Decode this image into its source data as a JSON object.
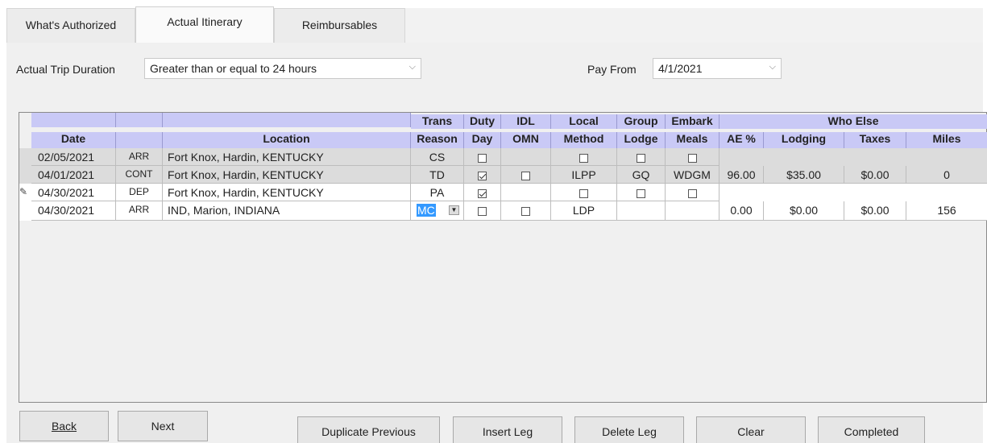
{
  "tabs": [
    {
      "label": "What's Authorized"
    },
    {
      "label": "Actual Itinerary"
    },
    {
      "label": "Reimbursables"
    }
  ],
  "trip_duration": {
    "label": "Actual Trip Duration",
    "value": "Greater than or equal to 24 hours"
  },
  "pay_from": {
    "label": "Pay From",
    "value": "4/1/2021"
  },
  "headers": {
    "date": "Date",
    "location": "Location",
    "trans_top": "Trans",
    "trans_bottom": "Reason",
    "duty_top": "Duty",
    "duty_bottom": "Day",
    "idl_top": "IDL",
    "idl_bottom": "OMN",
    "local_top": "Local",
    "local_bottom": "Method",
    "group_top": "Group",
    "group_bottom": "Lodge",
    "embark_top": "Embark",
    "embark_bottom": "Meals",
    "who_else": "Who Else",
    "ae": "AE %",
    "lodging": "Lodging",
    "taxes": "Taxes",
    "miles": "Miles"
  },
  "rows": [
    {
      "date": "02/05/2021",
      "type": "ARR",
      "location": "Fort Knox, Hardin, KENTUCKY",
      "reason": "CS",
      "local": "",
      "group": "",
      "embark": "",
      "ae": "",
      "lodging": "",
      "taxes": "",
      "miles": ""
    },
    {
      "date": "04/01/2021",
      "type": "CONT",
      "location": "Fort Knox, Hardin, KENTUCKY",
      "reason": "TD",
      "local": "ILPP",
      "group": "GQ",
      "embark": "WDGM",
      "ae": "96.00",
      "lodging": "$35.00",
      "taxes": "$0.00",
      "miles": "0"
    },
    {
      "date": "04/30/2021",
      "type": "DEP",
      "location": "Fort Knox, Hardin, KENTUCKY",
      "reason": "PA",
      "local": "",
      "group": "",
      "embark": "",
      "ae": "",
      "lodging": "",
      "taxes": "",
      "miles": ""
    },
    {
      "date": "04/30/2021",
      "type": "ARR",
      "location": "IND, Marion, INDIANA",
      "reason": "MC",
      "local": "LDP",
      "group": "",
      "embark": "",
      "ae": "0.00",
      "lodging": "$0.00",
      "taxes": "$0.00",
      "miles": "156"
    }
  ],
  "buttons": {
    "back": "Back",
    "next": "Next",
    "duplicate": "Duplicate Previous",
    "insert": "Insert Leg",
    "delete": "Delete Leg",
    "clear": "Clear",
    "completed": "Completed"
  },
  "colors": {
    "header_bg": "#c9c9f6",
    "selection": "#3399ff"
  }
}
